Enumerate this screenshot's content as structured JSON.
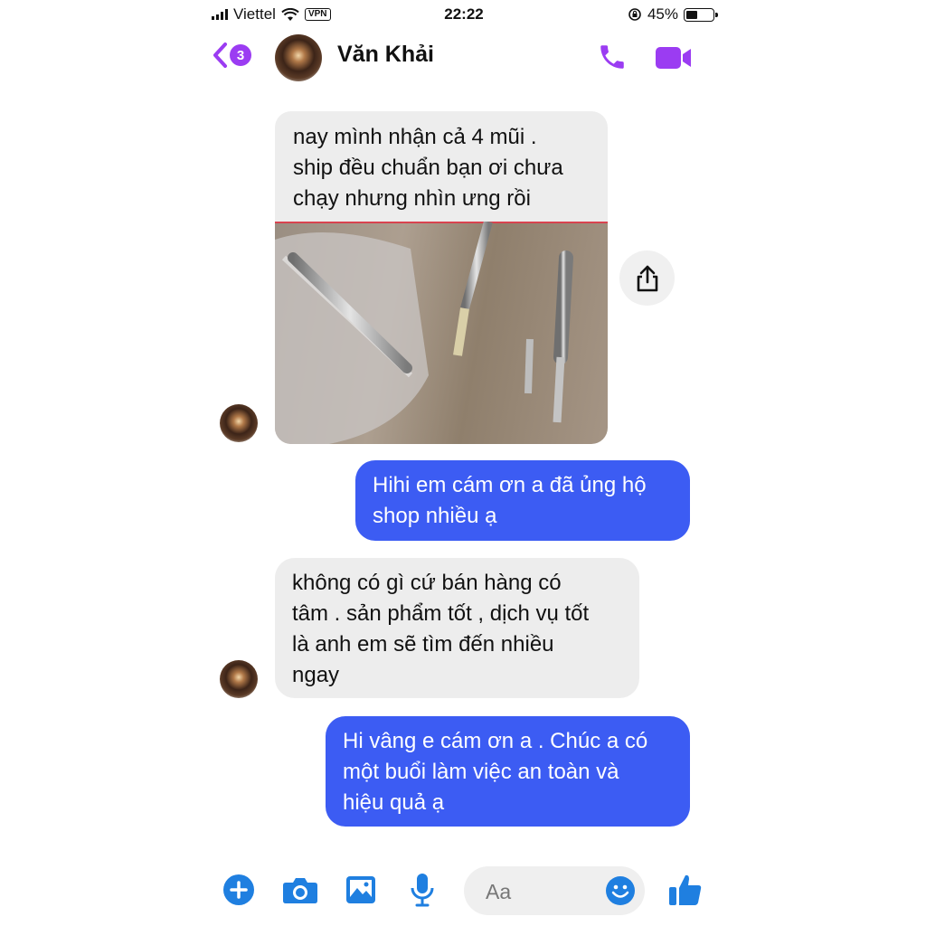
{
  "status_bar": {
    "carrier": "Viettel",
    "vpn": "VPN",
    "time": "22:22",
    "battery": "45%",
    "battery_level": 0.45
  },
  "header": {
    "back_badge": "3",
    "contact_name": "Văn Khải"
  },
  "messages": [
    {
      "from": "contact",
      "lines": [
        "nay mình nhận cả 4 mũi .",
        "ship đều chuẩn bạn ơi chưa",
        "chạy nhưng nhìn ưng rồi"
      ]
    },
    {
      "from": "me",
      "lines": [
        "Hihi em cám ơn a đã ủng hộ",
        "shop nhiều ạ"
      ]
    },
    {
      "from": "contact",
      "lines": [
        "không có gì cứ bán hàng có",
        "tâm . sản phẩm tốt , dịch vụ tốt",
        "là anh em sẽ tìm đến nhiều",
        "ngay"
      ]
    },
    {
      "from": "me",
      "lines": [
        "Hi vâng e cám ơn a . Chúc a có",
        "một buổi làm việc an toàn và",
        "hiệu quả ạ"
      ]
    }
  ],
  "composer": {
    "placeholder": "Aa"
  },
  "icons": [
    "signal-icon",
    "wifi-icon",
    "lock-rotation-icon",
    "battery-icon",
    "back-chevron-icon",
    "phone-icon",
    "video-icon",
    "share-icon",
    "plus-icon",
    "camera-icon",
    "image-icon",
    "microphone-icon",
    "emoji-icon",
    "thumbs-up-icon"
  ],
  "colors": {
    "accent": "#9b3cf2",
    "outgoing_bubble": "#3c5cf3",
    "incoming_bubble": "#ededed",
    "toolbar_icon": "#1f7fe0"
  }
}
